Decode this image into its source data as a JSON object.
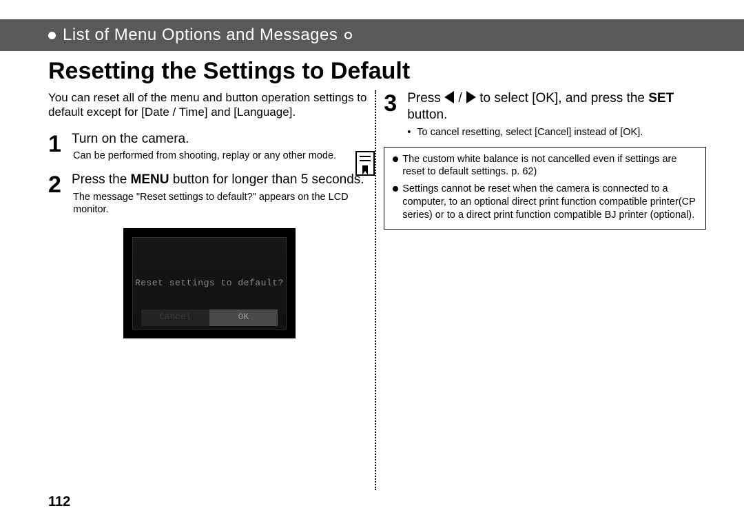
{
  "header": {
    "title": "List of Menu Options and Messages"
  },
  "page": {
    "title": "Resetting the Settings to Default",
    "number": "112"
  },
  "intro": "You can reset all of the menu and button operation settings to default except for [Date / Time] and [Language].",
  "steps": {
    "s1": {
      "num": "1",
      "main": "Turn on the camera.",
      "sub": "Can be performed from shooting, replay or any other mode."
    },
    "s2": {
      "num": "2",
      "main_pre": "Press the ",
      "main_bold": "MENU",
      "main_post": " button for longer than 5 seconds.",
      "sub": "The message \"Reset settings to default?\" appears on the LCD monitor."
    },
    "s3": {
      "num": "3",
      "main_pre": "Press ",
      "main_mid": " to select [OK], and press the ",
      "main_bold": "SET",
      "main_post": " button.",
      "sub": "To cancel resetting, select [Cancel] instead of [OK]."
    }
  },
  "lcd": {
    "message": "Reset settings to default?",
    "cancel": "Cancel",
    "ok": "OK"
  },
  "notes": {
    "n1": "The custom white balance is not cancelled even if settings are reset to default settings. p. 62)",
    "n2": "Settings cannot be reset when the camera is connected to a computer, to an optional direct print function compatible printer(CP series) or to a direct print function compatible BJ printer (optional)."
  }
}
